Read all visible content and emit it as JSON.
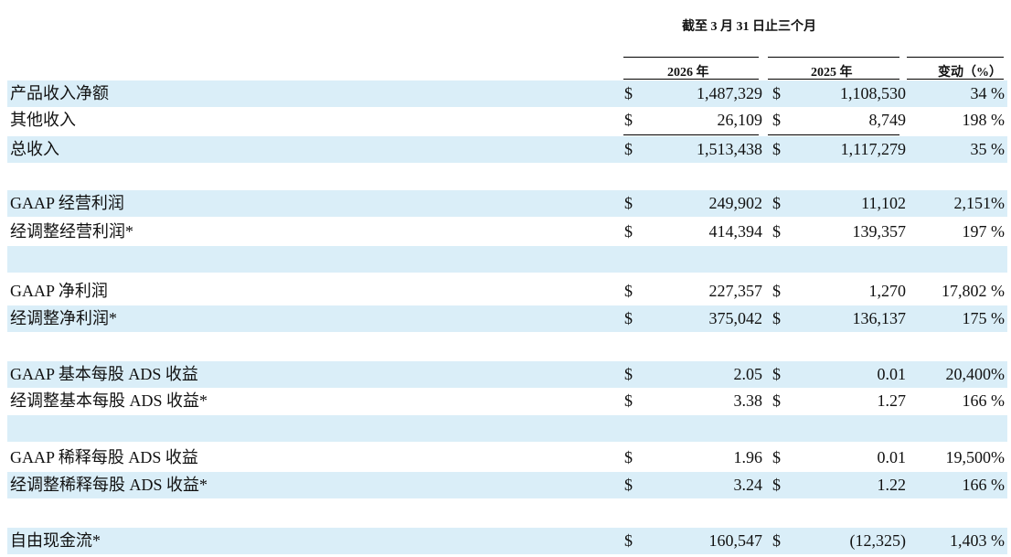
{
  "header": {
    "period": "截至 3 月 31 日止三个月",
    "col_2026": "2026 年",
    "col_2025": "2025 年",
    "col_change": "变动（%）"
  },
  "rows": [
    {
      "label": "产品收入净额",
      "d1": "$",
      "v1": "1,487,329",
      "d2": "$",
      "v2": "1,108,530",
      "pct": "34 %"
    },
    {
      "label": "其他收入",
      "d1": "$",
      "v1": "26,109",
      "d2": "$",
      "v2": "8,749",
      "pct": "198 %"
    },
    {
      "label": "总收入",
      "d1": "$",
      "v1": "1,513,438",
      "d2": "$",
      "v2": "1,117,279",
      "pct": "35 %"
    },
    {
      "label": "",
      "d1": "",
      "v1": "",
      "d2": "",
      "v2": "",
      "pct": ""
    },
    {
      "label": "GAAP 经营利润",
      "d1": "$",
      "v1": "249,902",
      "d2": "$",
      "v2": "11,102",
      "pct": "2,151%"
    },
    {
      "label": "经调整经营利润*",
      "d1": "$",
      "v1": "414,394",
      "d2": "$",
      "v2": "139,357",
      "pct": "197 %"
    },
    {
      "label": "",
      "d1": "",
      "v1": "",
      "d2": "",
      "v2": "",
      "pct": ""
    },
    {
      "label": "GAAP 净利润",
      "d1": "$",
      "v1": "227,357",
      "d2": "$",
      "v2": "1,270",
      "pct": "17,802 %"
    },
    {
      "label": "经调整净利润*",
      "d1": "$",
      "v1": "375,042",
      "d2": "$",
      "v2": "136,137",
      "pct": "175 %"
    },
    {
      "label": "",
      "d1": "",
      "v1": "",
      "d2": "",
      "v2": "",
      "pct": ""
    },
    {
      "label": "GAAP 基本每股 ADS 收益",
      "d1": "$",
      "v1": "2.05",
      "d2": "$",
      "v2": "0.01",
      "pct": "20,400%"
    },
    {
      "label": "经调整基本每股 ADS 收益*",
      "d1": "$",
      "v1": "3.38",
      "d2": "$",
      "v2": "1.27",
      "pct": "166 %"
    },
    {
      "label": "",
      "d1": "",
      "v1": "",
      "d2": "",
      "v2": "",
      "pct": ""
    },
    {
      "label": "GAAP 稀释每股 ADS 收益",
      "d1": "$",
      "v1": "1.96",
      "d2": "$",
      "v2": "0.01",
      "pct": "19,500%"
    },
    {
      "label": "经调整稀释每股 ADS 收益*",
      "d1": "$",
      "v1": "3.24",
      "d2": "$",
      "v2": "1.22",
      "pct": "166 %"
    },
    {
      "label": "",
      "d1": "",
      "v1": "",
      "d2": "",
      "v2": "",
      "pct": ""
    },
    {
      "label": "自由现金流*",
      "d1": "$",
      "v1": "160,547",
      "d2": "$",
      "v2": "(12,325)",
      "pct": "1,403 %"
    }
  ]
}
